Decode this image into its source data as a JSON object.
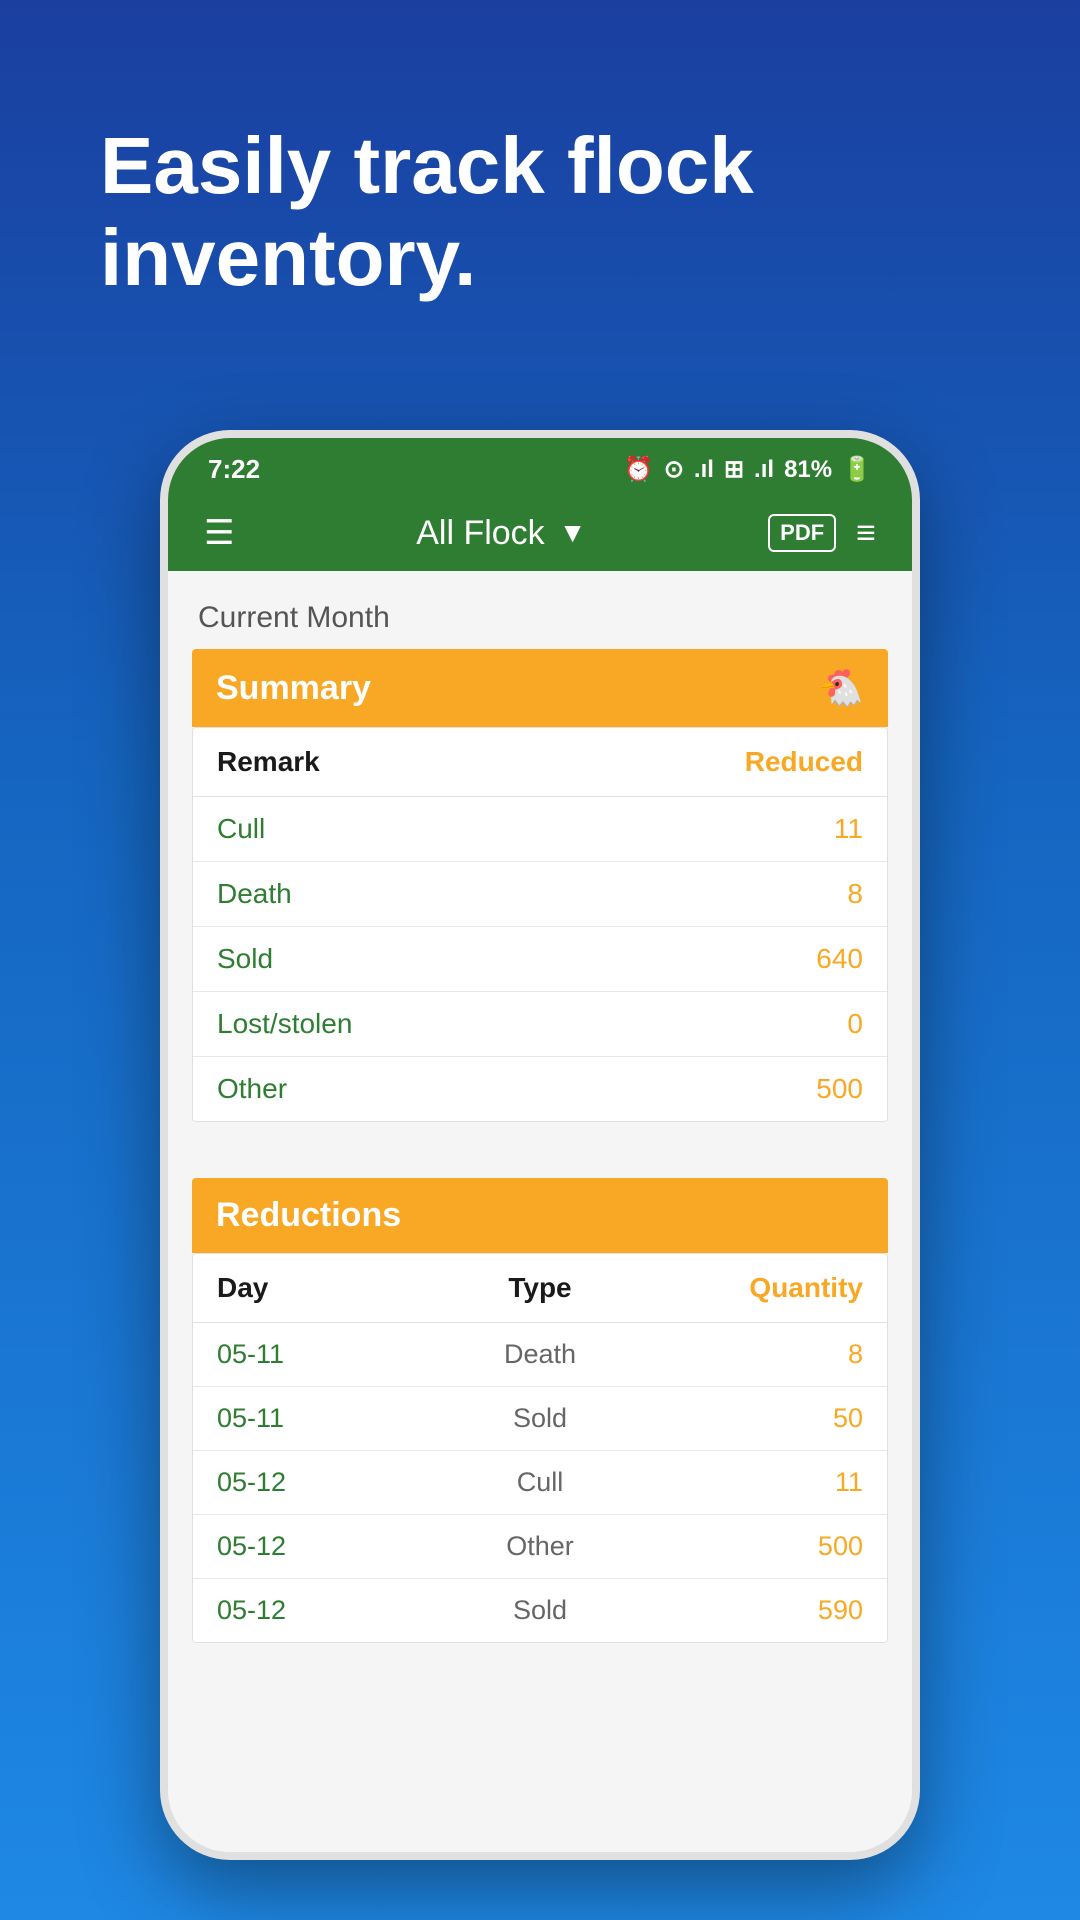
{
  "headline": "Easily track flock inventory.",
  "status_bar": {
    "time": "7:22",
    "battery": "81%",
    "signal_icons": "⏰ ⊙ .ıl ⊞ .ıl"
  },
  "app_bar": {
    "title": "All Flock",
    "pdf_label": "PDF"
  },
  "section_label": "Current Month",
  "summary_section": {
    "title": "Summary",
    "icon": "🐔",
    "col_remark": "Remark",
    "col_reduced": "Reduced",
    "rows": [
      {
        "label": "Cull",
        "value": "11"
      },
      {
        "label": "Death",
        "value": "8"
      },
      {
        "label": "Sold",
        "value": "640"
      },
      {
        "label": "Lost/stolen",
        "value": "0"
      },
      {
        "label": "Other",
        "value": "500"
      }
    ]
  },
  "reductions_section": {
    "title": "Reductions",
    "col_day": "Day",
    "col_type": "Type",
    "col_quantity": "Quantity",
    "rows": [
      {
        "day": "05-11",
        "type": "Death",
        "quantity": "8"
      },
      {
        "day": "05-11",
        "type": "Sold",
        "quantity": "50"
      },
      {
        "day": "05-12",
        "type": "Cull",
        "quantity": "11"
      },
      {
        "day": "05-12",
        "type": "Other",
        "quantity": "500"
      },
      {
        "day": "05-12",
        "type": "Sold",
        "quantity": "590"
      }
    ]
  }
}
